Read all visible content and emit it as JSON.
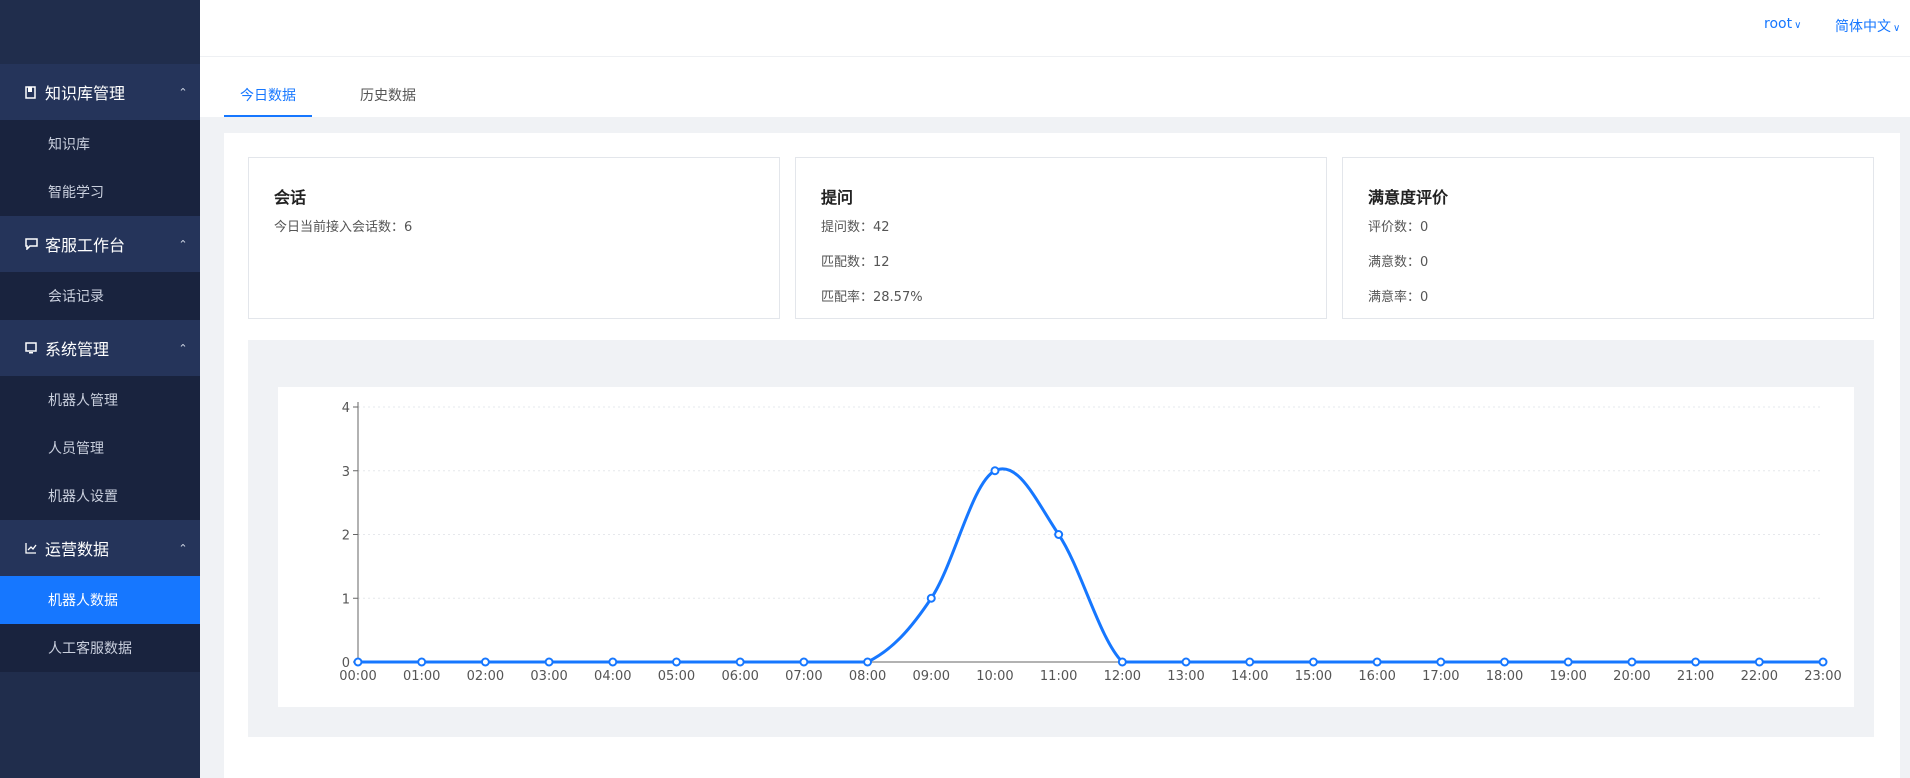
{
  "sidebar": {
    "groups": [
      {
        "label": "知识库管理",
        "icon": "book-icon",
        "items": [
          "知识库",
          "智能学习"
        ]
      },
      {
        "label": "客服工作台",
        "icon": "chat-icon",
        "items": [
          "会话记录"
        ]
      },
      {
        "label": "系统管理",
        "icon": "monitor-icon",
        "items": [
          "机器人管理",
          "人员管理",
          "机器人设置"
        ]
      },
      {
        "label": "运营数据",
        "icon": "chart-icon",
        "items": [
          "机器人数据",
          "人工客服数据"
        ]
      }
    ],
    "active_item": "机器人数据"
  },
  "header": {
    "user": "root",
    "language": "简体中文"
  },
  "tabs": [
    {
      "label": "今日数据",
      "active": true
    },
    {
      "label": "历史数据",
      "active": false
    }
  ],
  "cards": {
    "session": {
      "title": "会话",
      "rows": [
        "今日当前接入会话数：6"
      ]
    },
    "question": {
      "title": "提问",
      "rows": [
        "提问数：42",
        "匹配数：12",
        "匹配率：28.57%"
      ]
    },
    "satisfaction": {
      "title": "满意度评价",
      "rows": [
        "评价数：0",
        "满意数：0",
        "满意率：0"
      ]
    }
  },
  "chart_data": {
    "type": "line",
    "x": [
      "00:00",
      "01:00",
      "02:00",
      "03:00",
      "04:00",
      "05:00",
      "06:00",
      "07:00",
      "08:00",
      "09:00",
      "10:00",
      "11:00",
      "12:00",
      "13:00",
      "14:00",
      "15:00",
      "16:00",
      "17:00",
      "18:00",
      "19:00",
      "20:00",
      "21:00",
      "22:00",
      "23:00"
    ],
    "series": [
      {
        "values": [
          0,
          0,
          0,
          0,
          0,
          0,
          0,
          0,
          0,
          1,
          3,
          2,
          0,
          0,
          0,
          0,
          0,
          0,
          0,
          0,
          0,
          0,
          0,
          0
        ]
      }
    ],
    "ylim": [
      0,
      4
    ],
    "yticks": [
      0,
      1,
      2,
      3,
      4
    ],
    "grid": true,
    "color": "#1677ff"
  }
}
